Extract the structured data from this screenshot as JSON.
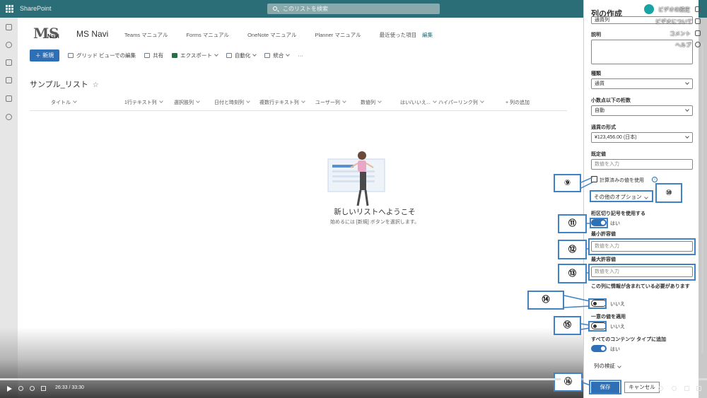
{
  "suite": {
    "title": "SharePoint",
    "search_placeholder": "このリストを検索"
  },
  "site": {
    "logo_text": "MS",
    "logo_sub": "Navi",
    "name": "MS Navi",
    "nav": [
      "Teams マニュアル",
      "Forms マニュアル",
      "OneNote マニュアル",
      "Planner マニュアル",
      "最近使った項目"
    ],
    "nav_edit": "編集"
  },
  "commands": {
    "new": "新規",
    "grid_edit": "グリッド ビューでの編集",
    "share": "共有",
    "export": "エクスポート",
    "automate": "自動化",
    "integrate": "統合",
    "more": "···"
  },
  "list": {
    "title": "サンプル_リスト",
    "star": "☆",
    "columns": [
      "タイトル",
      "1行テキスト列",
      "選択肢列",
      "日付と時刻列",
      "複数行テキスト列",
      "ユーザー列",
      "数値列",
      "はい/いいえ...",
      "ハイパーリンク列",
      "+ 列の追加"
    ],
    "welcome_title": "新しいリストへようこそ",
    "welcome_sub": "始めるには [新規] ボタンを選択します。"
  },
  "panel": {
    "title": "列の作成",
    "top_value": "通貨列",
    "description_label": "説明",
    "type_label": "種類",
    "type_value": "通貨",
    "decimals_label": "小数点以下の桁数",
    "decimals_value": "自動",
    "currency_format_label": "通貨の形式",
    "currency_format_value": "¥123,456.00 (日本)",
    "default_label": "既定値",
    "default_placeholder": "数値を入力",
    "calculated_label": "計算済みの値を使用",
    "more_options": "その他のオプション",
    "thousands_label": "桁区切り記号を使用する",
    "thousands_value": "はい",
    "min_label": "最小許容値",
    "min_placeholder": "数値を入力",
    "max_label": "最大許容値",
    "max_placeholder": "数値を入力",
    "required_label": "この列に情報が含まれている必要があります",
    "required_value": "いいえ",
    "unique_label": "一意の値を適用",
    "unique_value": "いいえ",
    "all_content_label": "すべてのコンテンツ タイプに追加",
    "all_content_value": "はい",
    "validation": "列の検証",
    "save": "保存",
    "cancel": "キャンセル"
  },
  "video": {
    "settings": "ビデオの設定",
    "about": "ビデオについて",
    "comment": "コメント",
    "help": "ヘルプ",
    "time": "26:33 / 33:30",
    "progress": 0.793
  },
  "callouts": [
    "⑨",
    "⑩",
    "⑪",
    "⑫",
    "⑬",
    "⑭",
    "⑮",
    "⑯"
  ],
  "colors": {
    "suitebar": "#2b6e78",
    "accent": "#2f6fb6",
    "callout_border": "#3f82c6"
  }
}
